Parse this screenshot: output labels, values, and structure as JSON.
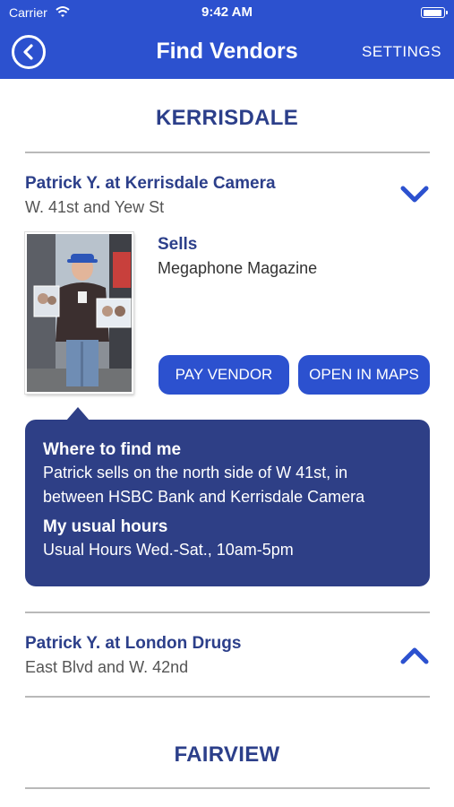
{
  "status_bar": {
    "carrier": "Carrier",
    "time": "9:42 AM"
  },
  "nav": {
    "title": "Find Vendors",
    "settings_label": "SETTINGS"
  },
  "sections": [
    {
      "title": "KERRISDALE",
      "vendors": [
        {
          "name": "Patrick Y. at Kerrisdale Camera",
          "address": "W. 41st and Yew St",
          "expanded": true,
          "sells_label": "Sells",
          "sells_value": "Megaphone Magazine",
          "pay_label": "PAY VENDOR",
          "maps_label": "OPEN IN MAPS",
          "where_label": "Where to find me",
          "where_line1": "Patrick sells on the north side of W 41st, in",
          "where_line2": "between HSBC Bank and Kerrisdale Camera",
          "hours_label": "My usual hours",
          "hours_value": "Usual Hours Wed.-Sat., 10am-5pm"
        },
        {
          "name": "Patrick Y. at London Drugs",
          "address": "East Blvd and W. 42nd",
          "expanded": false
        }
      ]
    },
    {
      "title": "FAIRVIEW"
    }
  ],
  "colors": {
    "brand_blue": "#2c51cf",
    "navy": "#2c3f8a",
    "card_navy": "#2e3f86"
  },
  "icons": [
    "back-circle-icon",
    "wifi-icon",
    "battery-icon",
    "chevron-down-icon",
    "chevron-up-icon"
  ]
}
